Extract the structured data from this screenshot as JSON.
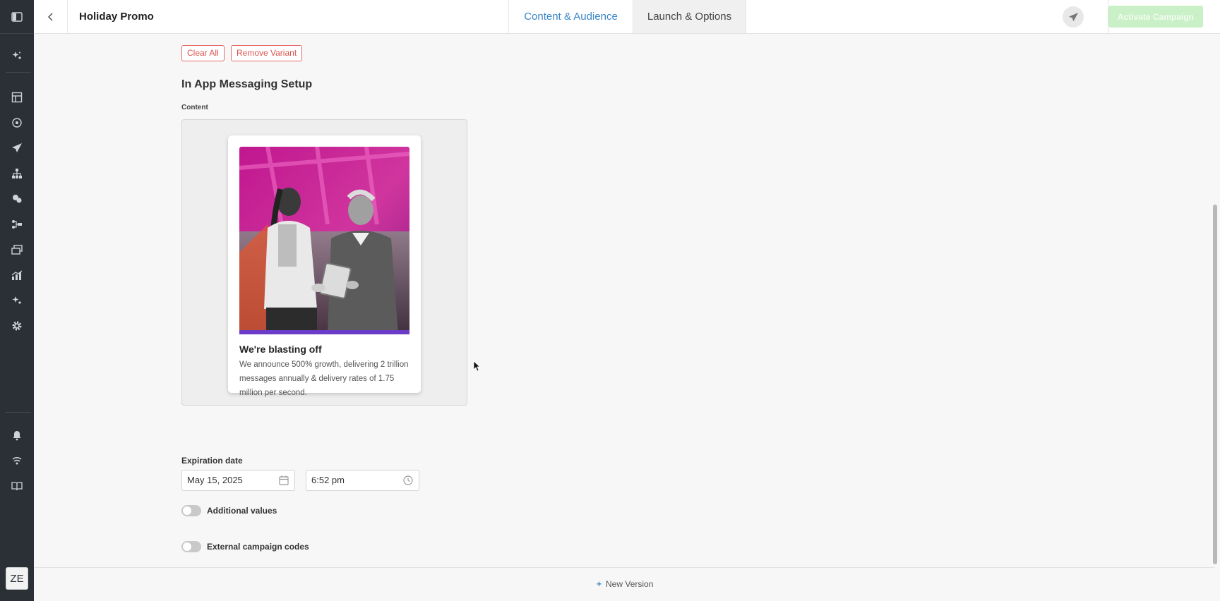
{
  "header": {
    "title": "Holiday Promo",
    "tabs": [
      {
        "label": "Content & Audience",
        "active": true
      },
      {
        "label": "Launch & Options",
        "active": false
      }
    ],
    "activate_label": "Activate Campaign"
  },
  "toolbar": {
    "clear_all": "Clear All",
    "remove_variant": "Remove Variant"
  },
  "setup": {
    "section_title": "In App Messaging Setup",
    "content_label": "Content"
  },
  "preview": {
    "title": "We're blasting off",
    "body": "We announce 500% growth, delivering 2 trillion messages annually & delivery rates of 1.75 million per second."
  },
  "expiration": {
    "label": "Expiration date",
    "date": "May 15, 2025",
    "time": "6:52 pm"
  },
  "toggles": {
    "additional_values": "Additional values",
    "external_codes": "External campaign codes"
  },
  "footer": {
    "new_version": "New Version"
  },
  "user": {
    "initials": "ZE"
  },
  "colors": {
    "accent": "#3a86c8",
    "danger": "#d9534f",
    "activate_disabled": "#c9f0c6",
    "sidebar": "#2b2f36"
  }
}
